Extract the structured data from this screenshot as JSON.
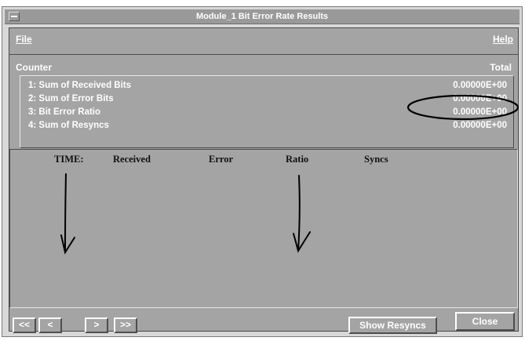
{
  "window": {
    "title": "Module_1 Bit Error Rate Results"
  },
  "menu": {
    "file": "File",
    "help": "Help"
  },
  "counters": {
    "header_counter": "Counter",
    "header_total": "Total",
    "rows": [
      {
        "label": "1: Sum of Received Bits",
        "value": "0.00000E+00"
      },
      {
        "label": "2: Sum of Error Bits",
        "value": "0.00000E+00"
      },
      {
        "label": "3: Bit Error Ratio",
        "value": "0.00000E+00"
      },
      {
        "label": "4: Sum of Resyncs",
        "value": "0.00000E+00"
      }
    ]
  },
  "log": {
    "columns": [
      "TIME:",
      "Received",
      "Error",
      "Ratio",
      "Syncs"
    ]
  },
  "nav": {
    "first": "<<",
    "prev": "<",
    "next": ">",
    "last": ">>"
  },
  "buttons": {
    "show_resyncs": "Show Resyncs",
    "close": "Close"
  },
  "colors": {
    "panel": "#a4a4a4",
    "titlebar": "#999999",
    "text_light": "#ffffff",
    "annotation_ink": "#000000"
  }
}
